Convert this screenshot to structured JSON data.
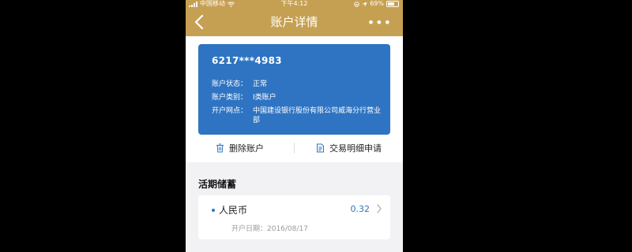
{
  "status_bar": {
    "carrier": "中国移动",
    "time": "下午4:12",
    "battery": "69%"
  },
  "nav": {
    "title": "账户详情",
    "more": "•••"
  },
  "card": {
    "number": "6217***4983",
    "status_label": "账户状态：",
    "status_value": "正常",
    "type_label": "账户类别：",
    "type_value": "I类账户",
    "branch_label": "开户网点：",
    "branch_value": "中国建设银行股份有限公司威海分行营业部"
  },
  "actions": {
    "delete_label": "删除账户",
    "detail_label": "交易明细申请"
  },
  "section": {
    "title": "活期储蓄"
  },
  "account": {
    "currency": "人民币",
    "balance": "0.32",
    "open_date": "开户日期：2016/08/17"
  },
  "colors": {
    "header": "#c6a052",
    "card": "#2f74c2",
    "accent": "#2f74c2"
  }
}
